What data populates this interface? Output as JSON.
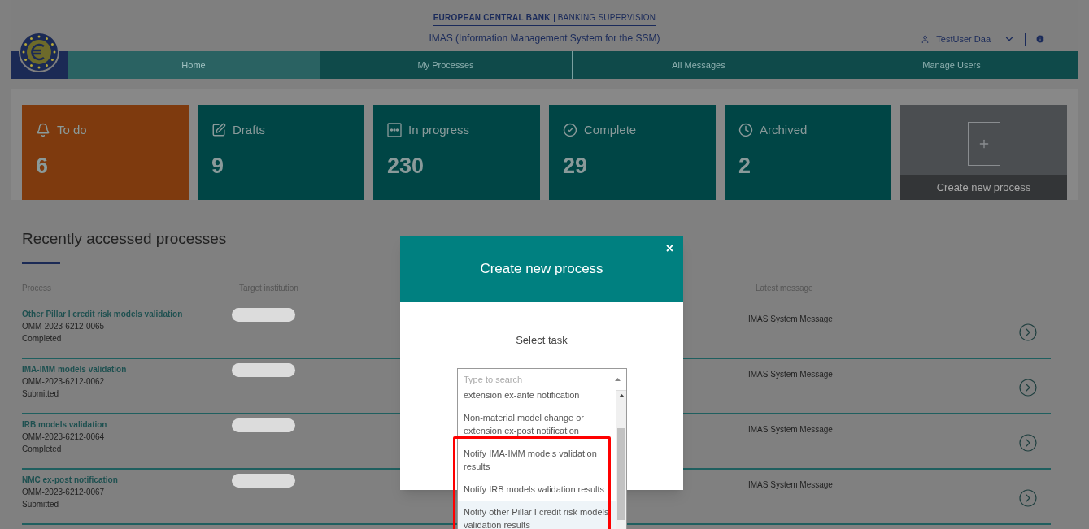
{
  "header": {
    "brand": "EUROPEAN CENTRAL BANK",
    "brand_sub": "BANKING SUPERVISION",
    "app_title": "IMAS (Information Management System for the SSM)",
    "user": "TestUser Daa"
  },
  "nav": [
    {
      "label": "Home",
      "selected": true
    },
    {
      "label": "My Processes",
      "selected": false
    },
    {
      "label": "All Messages",
      "selected": false
    },
    {
      "label": "Manage Users",
      "selected": false
    }
  ],
  "tiles": [
    {
      "kind": "todo",
      "label": "To do",
      "count": "6"
    },
    {
      "kind": "drafts",
      "label": "Drafts",
      "count": "9"
    },
    {
      "kind": "progress",
      "label": "In progress",
      "count": "230"
    },
    {
      "kind": "complete",
      "label": "Complete",
      "count": "29"
    },
    {
      "kind": "archived",
      "label": "Archived",
      "count": "2"
    },
    {
      "kind": "create",
      "label": "Create new process"
    }
  ],
  "recent": {
    "title": "Recently accessed processes",
    "columns": [
      "Process",
      "Target institution",
      "Latest message"
    ],
    "rows": [
      {
        "name": "Other Pillar I credit risk models validation",
        "id": "OMM-2023-6212-0065",
        "status": "Completed",
        "message": "IMAS System Message"
      },
      {
        "name": "IMA-IMM models validation",
        "id": "OMM-2023-6212-0062",
        "status": "Submitted",
        "message": "IMAS System Message"
      },
      {
        "name": "IRB models validation",
        "id": "OMM-2023-6212-0064",
        "status": "Completed",
        "message": "IMAS System Message"
      },
      {
        "name": "NMC ex-post notification",
        "id": "OMM-2023-6212-0067",
        "status": "Submitted",
        "message": "IMAS System Message"
      }
    ]
  },
  "modal": {
    "title": "Create new process",
    "close": "×",
    "prompt": "Select task",
    "search": {
      "placeholder": "Type to search"
    },
    "options": [
      {
        "label": "extension ex-ante notification",
        "highlighted": false
      },
      {
        "label": "Non-material model change or extension ex-post notification",
        "highlighted": false
      },
      {
        "label": "Notify IMA-IMM models validation results",
        "highlighted": false
      },
      {
        "label": "Notify IRB models validation results",
        "highlighted": false
      },
      {
        "label": "Notify other Pillar I credit risk models validation results",
        "highlighted": true
      }
    ]
  }
}
